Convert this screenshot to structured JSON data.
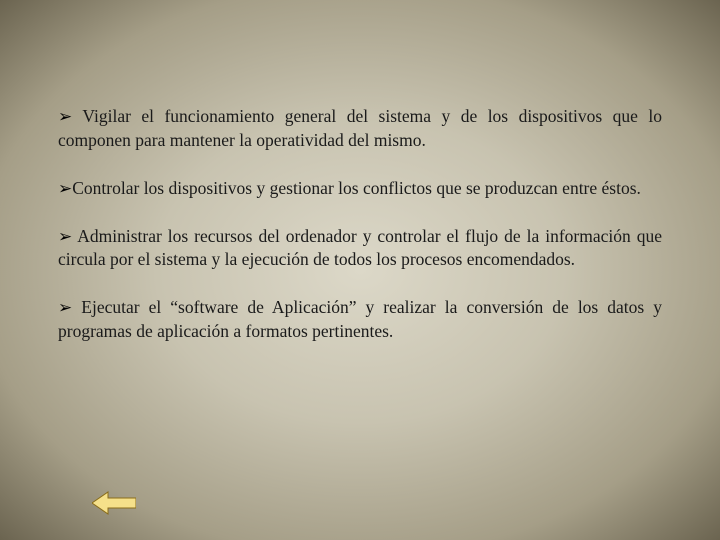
{
  "bullets": [
    {
      "text": "Vigilar el funcionamiento general del sistema y de los dispositivos que lo componen para mantener la operatividad del mismo."
    },
    {
      "text": "Controlar los dispositivos y gestionar los conflictos que se produzcan entre éstos."
    },
    {
      "text": "Administrar los recursos del ordenador y controlar el flujo de la información que circula por el sistema y la ejecución de todos los procesos encomendados."
    },
    {
      "text": "Ejecutar el “software de Aplicación” y realizar la conversión de los datos y programas de aplicación a formatos pertinentes."
    }
  ],
  "marker": "➢"
}
